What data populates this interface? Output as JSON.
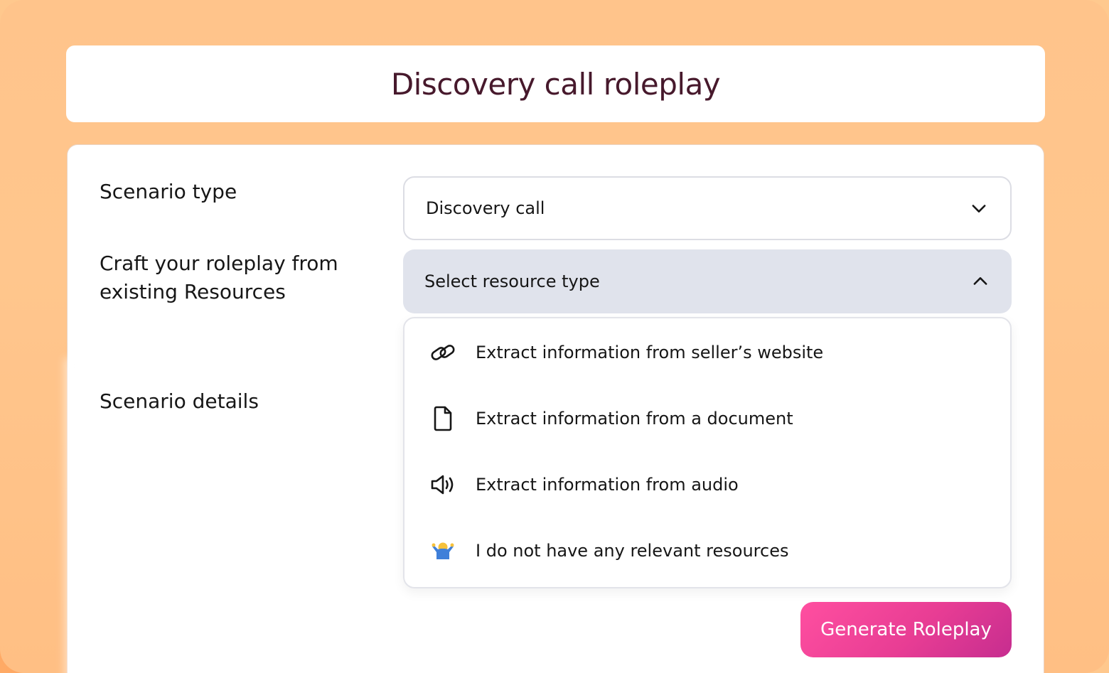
{
  "page": {
    "title": "Discovery call roleplay"
  },
  "form": {
    "scenario_type_label": "Scenario type",
    "resources_label": "Craft your roleplay from existing Resources",
    "scenario_details_label": "Scenario details",
    "scenario_type_value": "Discovery call",
    "resource_select_placeholder": "Select resource type",
    "resource_options": [
      {
        "label": "Extract information from seller’s website",
        "icon": "link-icon"
      },
      {
        "label": "Extract information from a document",
        "icon": "document-icon"
      },
      {
        "label": "Extract information from audio",
        "icon": "speaker-icon"
      },
      {
        "label": "I do not have any relevant resources",
        "icon": "person-shrug-icon"
      }
    ],
    "generate_button_label": "Generate Roleplay"
  },
  "colors": {
    "background": "#ffc48b",
    "title_text": "#47192c",
    "open_select_bg": "#e0e3ec",
    "button_gradient_start": "#ff4fa0",
    "button_gradient_end": "#c62d8f"
  }
}
